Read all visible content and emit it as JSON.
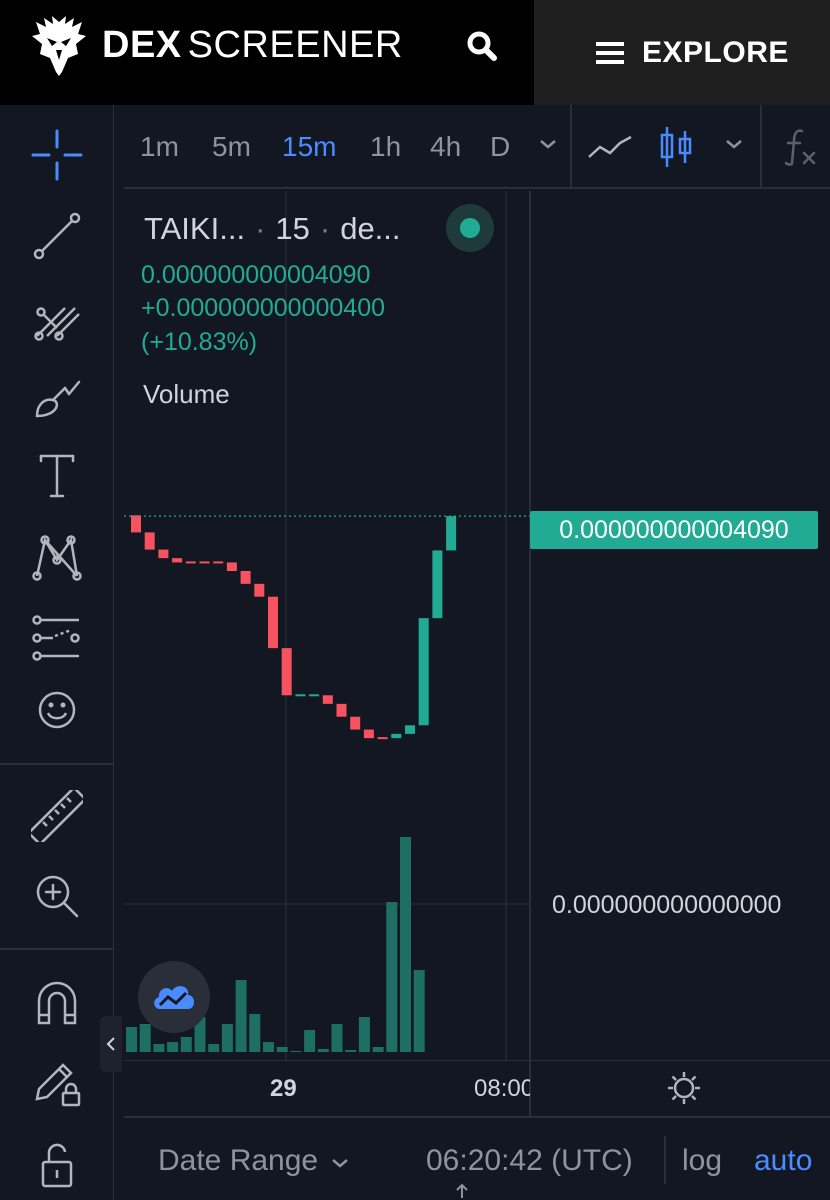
{
  "header": {
    "brand_bold": "DEX",
    "brand_light": "SCREENER",
    "explore_label": "EXPLORE"
  },
  "intervals": {
    "items": [
      "1m",
      "5m",
      "15m",
      "1h",
      "4h",
      "D"
    ],
    "active": "15m"
  },
  "legend": {
    "symbol": "TAIKI...",
    "interval": "15",
    "exchange": "de...",
    "price": "0.000000000004090",
    "change_abs": "+0.000000000000400",
    "change_pct": "(+10.83%)",
    "volume_label": "Volume"
  },
  "price_scale": {
    "last_price": "0.000000000004090",
    "zero_label": "0.000000000000000"
  },
  "time_axis": {
    "labels": [
      "29",
      "08:00"
    ]
  },
  "bottom_bar": {
    "date_range": "Date Range",
    "clock": "06:20:42 (UTC)",
    "log": "log",
    "auto": "auto"
  },
  "colors": {
    "up": "#22ab94",
    "down": "#f7525f",
    "accent": "#4a8cff",
    "background": "#131722"
  },
  "chart_data": {
    "type": "candlestick",
    "price_series": {
      "candles": [
        {
          "open": 4.1,
          "close": 3.9,
          "dir": "down"
        },
        {
          "open": 3.9,
          "close": 3.7,
          "dir": "down"
        },
        {
          "open": 3.7,
          "close": 3.6,
          "dir": "down"
        },
        {
          "open": 3.6,
          "close": 3.55,
          "dir": "down"
        },
        {
          "open": 3.55,
          "close": 3.55,
          "dir": "down"
        },
        {
          "open": 3.55,
          "close": 3.55,
          "dir": "down"
        },
        {
          "open": 3.55,
          "close": 3.55,
          "dir": "down"
        },
        {
          "open": 3.55,
          "close": 3.45,
          "dir": "down"
        },
        {
          "open": 3.45,
          "close": 3.3,
          "dir": "down"
        },
        {
          "open": 3.3,
          "close": 3.15,
          "dir": "down"
        },
        {
          "open": 3.15,
          "close": 2.55,
          "dir": "down"
        },
        {
          "open": 2.55,
          "close": 2.0,
          "dir": "down"
        },
        {
          "open": 2.0,
          "close": 2.0,
          "dir": "up"
        },
        {
          "open": 2.0,
          "close": 2.0,
          "dir": "up"
        },
        {
          "open": 2.0,
          "close": 1.9,
          "dir": "down"
        },
        {
          "open": 1.9,
          "close": 1.75,
          "dir": "down"
        },
        {
          "open": 1.75,
          "close": 1.6,
          "dir": "down"
        },
        {
          "open": 1.6,
          "close": 1.5,
          "dir": "down"
        },
        {
          "open": 1.5,
          "close": 1.5,
          "dir": "down"
        },
        {
          "open": 1.5,
          "close": 1.55,
          "dir": "up"
        },
        {
          "open": 1.55,
          "close": 1.65,
          "dir": "up"
        },
        {
          "open": 1.65,
          "close": 2.9,
          "dir": "up"
        },
        {
          "open": 2.9,
          "close": 3.69,
          "dir": "up"
        },
        {
          "open": 3.69,
          "close": 4.09,
          "dir": "up"
        }
      ],
      "last_price": 4.09
    },
    "volume_series": {
      "values": [
        25,
        28,
        8,
        10,
        15,
        35,
        8,
        28,
        72,
        38,
        10,
        5,
        0,
        22,
        3,
        28,
        2,
        35,
        5,
        150,
        215,
        82
      ]
    }
  }
}
